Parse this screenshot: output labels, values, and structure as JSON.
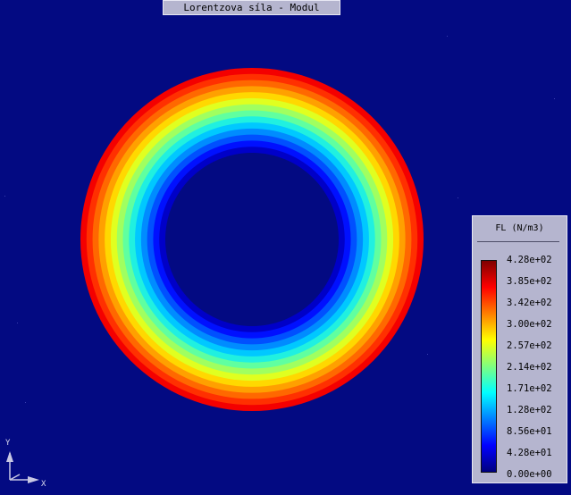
{
  "window": {
    "title": "Lorentzova síla - Modul"
  },
  "legend": {
    "title": "FL (N/m3)",
    "ticks": [
      "4.28e+02",
      "3.85e+02",
      "3.42e+02",
      "3.00e+02",
      "2.57e+02",
      "2.14e+02",
      "1.71e+02",
      "1.28e+02",
      "8.56e+01",
      "4.28e+01",
      "0.00e+00"
    ],
    "colormap": [
      "#00007f",
      "#0000ff",
      "#007fff",
      "#00ffff",
      "#7fff7f",
      "#ffff00",
      "#ff7f00",
      "#ff0000",
      "#7f0000"
    ]
  },
  "plot": {
    "background": "#030a82",
    "inner_color": "#030a82",
    "band_colors": [
      "#0000c8",
      "#0010ff",
      "#0050ff",
      "#008cff",
      "#00c8ff",
      "#20f0e0",
      "#60ffa0",
      "#a0ff60",
      "#e0ff20",
      "#ffd800",
      "#ffa000",
      "#ff6800",
      "#ff3000",
      "#f40000"
    ]
  },
  "axes": {
    "y_label": "Y",
    "x_label": "X"
  }
}
